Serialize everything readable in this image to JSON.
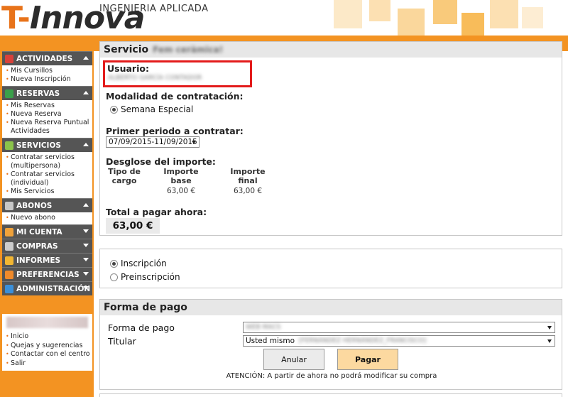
{
  "header": {
    "logo_letter": "T-",
    "logo_rest": "Innova",
    "logo_subtitle": "INGENIERIA APLICADA"
  },
  "sidebar": {
    "sections": [
      {
        "title": "ACTIVIDADES",
        "icon": "calendar-icon",
        "expanded": true,
        "links": [
          "Mis Cursillos",
          "Nueva Inscripción"
        ]
      },
      {
        "title": "RESERVAS",
        "icon": "reservas-icon",
        "expanded": true,
        "links": [
          "Mis Reservas",
          "Nueva Reserva",
          "Nueva Reserva Puntual Actividades"
        ]
      },
      {
        "title": "SERVICIOS",
        "icon": "servicios-icon",
        "expanded": true,
        "links": [
          "Contratar servicios (multipersona)",
          "Contratar servicios (individual)",
          "Mis Servicios"
        ]
      },
      {
        "title": "ABONOS",
        "icon": "abonos-icon",
        "expanded": true,
        "links": [
          "Nuevo abono"
        ]
      },
      {
        "title": "MI CUENTA",
        "icon": "user-icon",
        "expanded": false,
        "links": []
      },
      {
        "title": "COMPRAS",
        "icon": "cart-icon",
        "expanded": false,
        "links": []
      },
      {
        "title": "INFORMES",
        "icon": "chart-icon",
        "expanded": false,
        "links": []
      },
      {
        "title": "PREFERENCIAS",
        "icon": "wrench-icon",
        "expanded": false,
        "links": []
      },
      {
        "title": "ADMINISTRACIÓN",
        "icon": "globe-icon",
        "expanded": false,
        "links": []
      }
    ],
    "user_links": [
      "Inicio",
      "Quejas y sugerencias",
      "Contactar con el centro",
      "Salir"
    ]
  },
  "service": {
    "title_prefix": "Servicio",
    "usuario_label": "Usuario:",
    "modalidad_label": "Modalidad de contratación:",
    "modalidad_option": "Semana Especial",
    "periodo_label": "Primer periodo a contratar:",
    "periodo_value": "07/09/2015-11/09/2015",
    "desglose_label": "Desglose del importe:",
    "col_tipo": "Tipo de cargo",
    "col_base": "Importe base",
    "col_final": "Importe final",
    "base_value": "63,00 €",
    "final_value": "63,00 €",
    "total_label": "Total a pagar ahora:",
    "total_value": "63,00 €"
  },
  "inscription": {
    "option1": "Inscripción",
    "option2": "Preinscripción",
    "selected": "Inscripción"
  },
  "payment": {
    "title": "Forma de pago",
    "forma_label": "Forma de pago",
    "titular_label": "Titular",
    "titular_value": "Usted mismo",
    "cancel_label": "Anular",
    "pay_label": "Pagar",
    "warning": "ATENCIÓN: A partir de ahora no podrá modificar su compra"
  },
  "colors": {
    "brand_orange": "#f39322",
    "highlight_red": "#e31b1b",
    "sidebar_header": "#555555",
    "pay_button": "#fcd9a0"
  }
}
